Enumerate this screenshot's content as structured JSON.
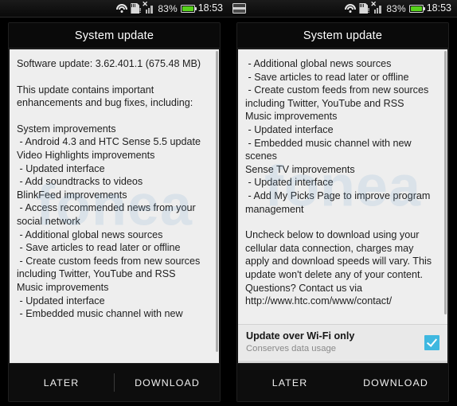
{
  "left_panel": {
    "statusbar": {
      "left_icons": [],
      "right_icons": [
        "wifi-icon",
        "sd-card-warning-icon",
        "no-signal-icon"
      ],
      "battery_percent": "83%",
      "time": "18:53"
    },
    "dialog": {
      "title": "System update",
      "paragraphs": [
        "Software update: 3.62.401.1 (675.48 MB)",
        "",
        "This update contains important enhancements and bug fixes, including:",
        "",
        "System improvements\n - Android 4.3 and HTC Sense 5.5 update\nVideo Highlights improvements\n - Updated interface\n - Add soundtracks to videos\nBlinkFeed improvements\n - Access recommended news from your social network\n - Additional global news sources\n - Save articles to read later or offline\n - Create custom feeds from new sources including Twitter, YouTube and RSS\nMusic improvements\n - Updated interface\n - Embedded music channel with new"
      ],
      "buttons": {
        "later": "LATER",
        "download": "DOWNLOAD"
      }
    }
  },
  "right_panel": {
    "statusbar": {
      "left_icons": [
        "screenshot-captured-icon"
      ],
      "right_icons": [
        "wifi-icon",
        "sd-card-warning-icon",
        "no-signal-icon"
      ],
      "battery_percent": "83%",
      "time": "18:53"
    },
    "dialog": {
      "title": "System update",
      "paragraphs": [
        " - Additional global news sources\n - Save articles to read later or offline\n - Create custom feeds from new sources including Twitter, YouTube and RSS\nMusic improvements\n - Updated interface\n - Embedded music channel with new scenes\nSense TV improvements\n - Updated interface\n - Add My Picks Page to improve program management",
        "",
        "Uncheck below to download using your cellular data connection, charges may apply and download speeds will vary. This update won't delete any of your content. Questions? Contact us via http://www.htc.com/www/contact/"
      ],
      "checkbox": {
        "title": "Update over Wi-Fi only",
        "subtitle": "Conserves data usage",
        "checked": true,
        "accent_color": "#3fb8e0"
      },
      "buttons": {
        "later": "LATER",
        "download": "DOWNLOAD"
      }
    }
  },
  "watermark": {
    "text": "fonea"
  }
}
